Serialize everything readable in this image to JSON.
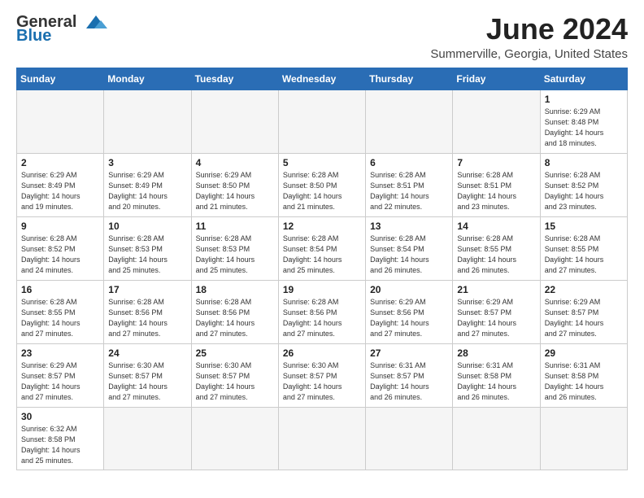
{
  "header": {
    "logo_line1": "General",
    "logo_line2": "Blue",
    "month_title": "June 2024",
    "location": "Summerville, Georgia, United States"
  },
  "weekdays": [
    "Sunday",
    "Monday",
    "Tuesday",
    "Wednesday",
    "Thursday",
    "Friday",
    "Saturday"
  ],
  "weeks": [
    [
      {
        "day": "",
        "info": ""
      },
      {
        "day": "",
        "info": ""
      },
      {
        "day": "",
        "info": ""
      },
      {
        "day": "",
        "info": ""
      },
      {
        "day": "",
        "info": ""
      },
      {
        "day": "",
        "info": ""
      },
      {
        "day": "1",
        "info": "Sunrise: 6:29 AM\nSunset: 8:48 PM\nDaylight: 14 hours\nand 18 minutes."
      }
    ],
    [
      {
        "day": "2",
        "info": "Sunrise: 6:29 AM\nSunset: 8:49 PM\nDaylight: 14 hours\nand 19 minutes."
      },
      {
        "day": "3",
        "info": "Sunrise: 6:29 AM\nSunset: 8:49 PM\nDaylight: 14 hours\nand 20 minutes."
      },
      {
        "day": "4",
        "info": "Sunrise: 6:29 AM\nSunset: 8:50 PM\nDaylight: 14 hours\nand 21 minutes."
      },
      {
        "day": "5",
        "info": "Sunrise: 6:28 AM\nSunset: 8:50 PM\nDaylight: 14 hours\nand 21 minutes."
      },
      {
        "day": "6",
        "info": "Sunrise: 6:28 AM\nSunset: 8:51 PM\nDaylight: 14 hours\nand 22 minutes."
      },
      {
        "day": "7",
        "info": "Sunrise: 6:28 AM\nSunset: 8:51 PM\nDaylight: 14 hours\nand 23 minutes."
      },
      {
        "day": "8",
        "info": "Sunrise: 6:28 AM\nSunset: 8:52 PM\nDaylight: 14 hours\nand 23 minutes."
      }
    ],
    [
      {
        "day": "9",
        "info": "Sunrise: 6:28 AM\nSunset: 8:52 PM\nDaylight: 14 hours\nand 24 minutes."
      },
      {
        "day": "10",
        "info": "Sunrise: 6:28 AM\nSunset: 8:53 PM\nDaylight: 14 hours\nand 25 minutes."
      },
      {
        "day": "11",
        "info": "Sunrise: 6:28 AM\nSunset: 8:53 PM\nDaylight: 14 hours\nand 25 minutes."
      },
      {
        "day": "12",
        "info": "Sunrise: 6:28 AM\nSunset: 8:54 PM\nDaylight: 14 hours\nand 25 minutes."
      },
      {
        "day": "13",
        "info": "Sunrise: 6:28 AM\nSunset: 8:54 PM\nDaylight: 14 hours\nand 26 minutes."
      },
      {
        "day": "14",
        "info": "Sunrise: 6:28 AM\nSunset: 8:55 PM\nDaylight: 14 hours\nand 26 minutes."
      },
      {
        "day": "15",
        "info": "Sunrise: 6:28 AM\nSunset: 8:55 PM\nDaylight: 14 hours\nand 27 minutes."
      }
    ],
    [
      {
        "day": "16",
        "info": "Sunrise: 6:28 AM\nSunset: 8:55 PM\nDaylight: 14 hours\nand 27 minutes."
      },
      {
        "day": "17",
        "info": "Sunrise: 6:28 AM\nSunset: 8:56 PM\nDaylight: 14 hours\nand 27 minutes."
      },
      {
        "day": "18",
        "info": "Sunrise: 6:28 AM\nSunset: 8:56 PM\nDaylight: 14 hours\nand 27 minutes."
      },
      {
        "day": "19",
        "info": "Sunrise: 6:28 AM\nSunset: 8:56 PM\nDaylight: 14 hours\nand 27 minutes."
      },
      {
        "day": "20",
        "info": "Sunrise: 6:29 AM\nSunset: 8:56 PM\nDaylight: 14 hours\nand 27 minutes."
      },
      {
        "day": "21",
        "info": "Sunrise: 6:29 AM\nSunset: 8:57 PM\nDaylight: 14 hours\nand 27 minutes."
      },
      {
        "day": "22",
        "info": "Sunrise: 6:29 AM\nSunset: 8:57 PM\nDaylight: 14 hours\nand 27 minutes."
      }
    ],
    [
      {
        "day": "23",
        "info": "Sunrise: 6:29 AM\nSunset: 8:57 PM\nDaylight: 14 hours\nand 27 minutes."
      },
      {
        "day": "24",
        "info": "Sunrise: 6:30 AM\nSunset: 8:57 PM\nDaylight: 14 hours\nand 27 minutes."
      },
      {
        "day": "25",
        "info": "Sunrise: 6:30 AM\nSunset: 8:57 PM\nDaylight: 14 hours\nand 27 minutes."
      },
      {
        "day": "26",
        "info": "Sunrise: 6:30 AM\nSunset: 8:57 PM\nDaylight: 14 hours\nand 27 minutes."
      },
      {
        "day": "27",
        "info": "Sunrise: 6:31 AM\nSunset: 8:57 PM\nDaylight: 14 hours\nand 26 minutes."
      },
      {
        "day": "28",
        "info": "Sunrise: 6:31 AM\nSunset: 8:58 PM\nDaylight: 14 hours\nand 26 minutes."
      },
      {
        "day": "29",
        "info": "Sunrise: 6:31 AM\nSunset: 8:58 PM\nDaylight: 14 hours\nand 26 minutes."
      }
    ],
    [
      {
        "day": "30",
        "info": "Sunrise: 6:32 AM\nSunset: 8:58 PM\nDaylight: 14 hours\nand 25 minutes."
      },
      {
        "day": "",
        "info": ""
      },
      {
        "day": "",
        "info": ""
      },
      {
        "day": "",
        "info": ""
      },
      {
        "day": "",
        "info": ""
      },
      {
        "day": "",
        "info": ""
      },
      {
        "day": "",
        "info": ""
      }
    ]
  ]
}
